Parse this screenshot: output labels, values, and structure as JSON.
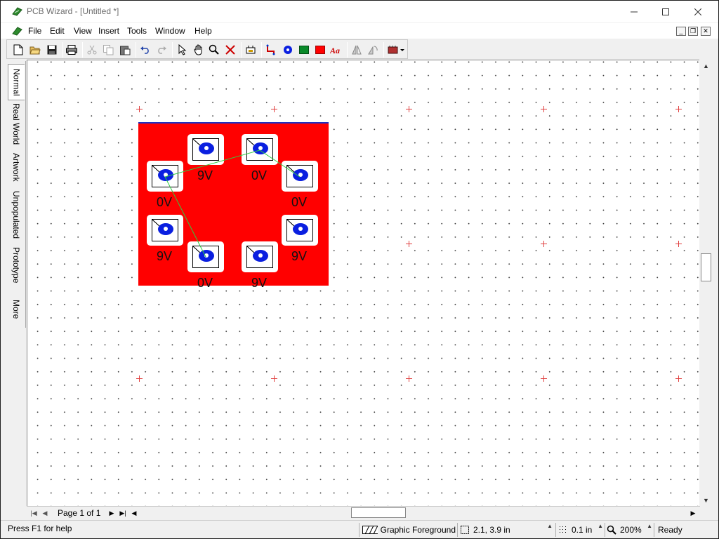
{
  "window": {
    "title": "PCB Wizard - [Untitled *]",
    "controls": {
      "minimize": "—",
      "maximize": "☐",
      "close": "✕"
    }
  },
  "menu": {
    "items": [
      "File",
      "Edit",
      "View",
      "Insert",
      "Tools",
      "Window",
      "Help"
    ]
  },
  "toolbar": {
    "buttons": [
      "new-icon",
      "open-icon",
      "save-icon",
      "print-icon",
      "cut-icon",
      "copy-icon",
      "paste-icon",
      "undo-icon",
      "redo-icon",
      "select-icon",
      "pan-icon",
      "zoom-icon",
      "delete-icon",
      "component-icon",
      "track-icon",
      "pad-icon",
      "rectangle-icon",
      "fill-icon",
      "text-icon",
      "flip-icon",
      "rotate-icon",
      "chip-icon"
    ]
  },
  "side_tabs": [
    "Normal",
    "Real World",
    "Artwork",
    "Unpopulated",
    "Prototype",
    "More"
  ],
  "board": {
    "color": "#ff0000",
    "pad_copper_color": "#0a1fe0",
    "track_color": "#2ecc40",
    "pads": [
      {
        "label": "9V"
      },
      {
        "label": "0V"
      },
      {
        "label": "0V"
      },
      {
        "label": "0V"
      },
      {
        "label": "9V"
      },
      {
        "label": "9V"
      },
      {
        "label": "0V"
      },
      {
        "label": "9V"
      }
    ]
  },
  "pager": {
    "label": "Page 1 of 1"
  },
  "status": {
    "help": "Press F1 for help",
    "layer": "Graphic Foreground",
    "coords": "2.1, 3.9 in",
    "grid": "0.1 in",
    "zoom": "200%",
    "state": "Ready"
  }
}
